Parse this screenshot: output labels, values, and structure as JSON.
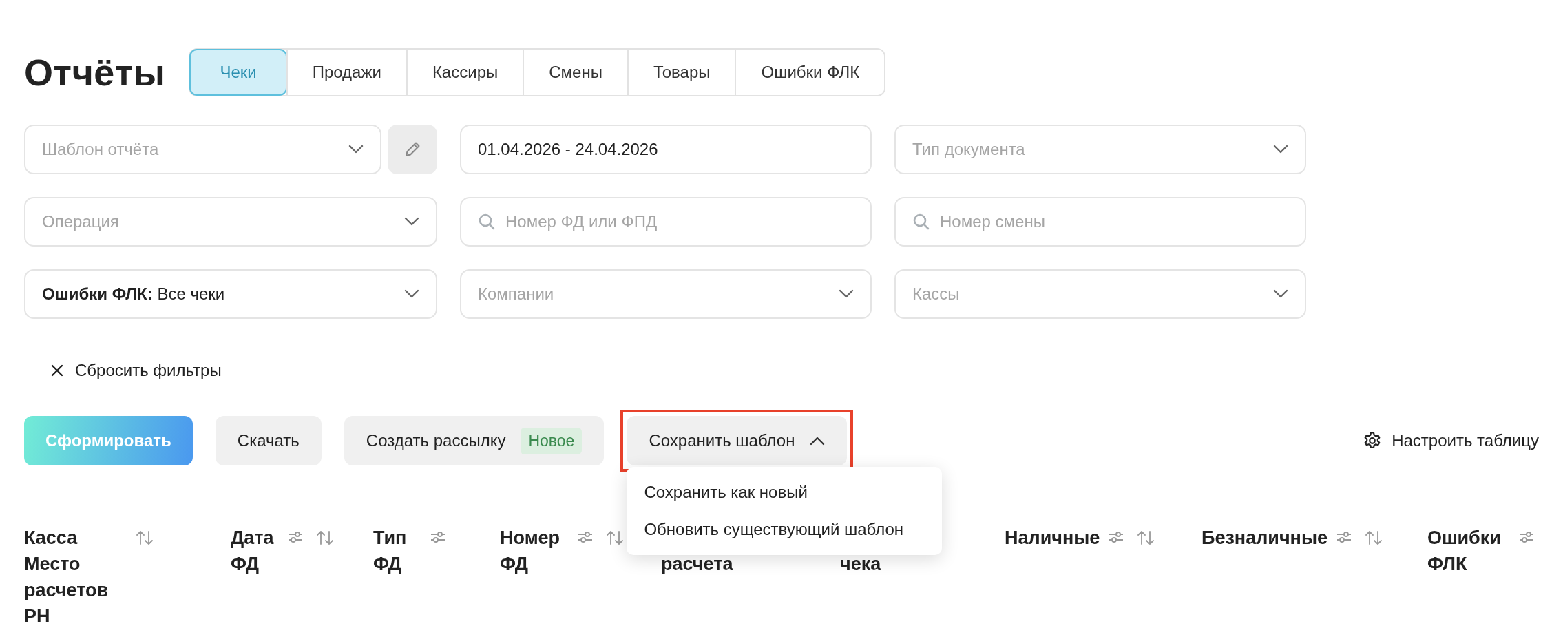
{
  "title": "Отчёты",
  "tabs": [
    {
      "label": "Чеки",
      "selected": true
    },
    {
      "label": "Продажи",
      "selected": false
    },
    {
      "label": "Кассиры",
      "selected": false
    },
    {
      "label": "Смены",
      "selected": false
    },
    {
      "label": "Товары",
      "selected": false
    },
    {
      "label": "Ошибки ФЛК",
      "selected": false
    }
  ],
  "filters": [
    {
      "kind": "select",
      "placeholder": "Шаблон отчёта",
      "edit_button": true
    },
    {
      "kind": "date",
      "value": "01.04.2026 - 24.04.2026"
    },
    {
      "kind": "select",
      "placeholder": "Тип документа"
    },
    {
      "kind": "select",
      "placeholder": "Операция"
    },
    {
      "kind": "search",
      "placeholder": "Номер ФД или ФПД"
    },
    {
      "kind": "search",
      "placeholder": "Номер смены"
    },
    {
      "kind": "select",
      "value": "**Ошибки ФЛК:** Все чеки"
    },
    {
      "kind": "select",
      "placeholder": "Компании"
    },
    {
      "kind": "select",
      "placeholder": "Кассы"
    }
  ],
  "reset_filters": "Сбросить фильтры",
  "actions": [
    {
      "kind": "primary",
      "label": "Сформировать"
    },
    {
      "kind": "secondary",
      "label": "Скачать"
    },
    {
      "kind": "secondary",
      "label": "Создать рассылку",
      "badge": "Новое"
    },
    {
      "kind": "menu",
      "label": "Сохранить шаблон",
      "expanded": true,
      "highlighted": true,
      "menu": [
        "Сохранить как новый",
        "Обновить существующий шаблон"
      ]
    }
  ],
  "table_settings": "Настроить таблицу",
  "columns": [
    {
      "label": "Касса Место расчетов РН",
      "filter": false,
      "sort": true
    },
    {
      "label": "Дата ФД",
      "filter": true,
      "sort": true
    },
    {
      "label": "Тип ФД",
      "filter": true,
      "sort": false
    },
    {
      "label": "Номер ФД",
      "filter": true,
      "sort": true
    },
    {
      "label": "расчета",
      "filter": false,
      "sort": false,
      "covered": true
    },
    {
      "label": "чека",
      "filter": false,
      "sort": false,
      "covered": true
    },
    {
      "label": "Наличные",
      "filter": true,
      "sort": true
    },
    {
      "label": "Безналичные",
      "filter": true,
      "sort": true
    },
    {
      "label": "Ошибки ФЛК",
      "filter": true,
      "sort": false
    }
  ]
}
